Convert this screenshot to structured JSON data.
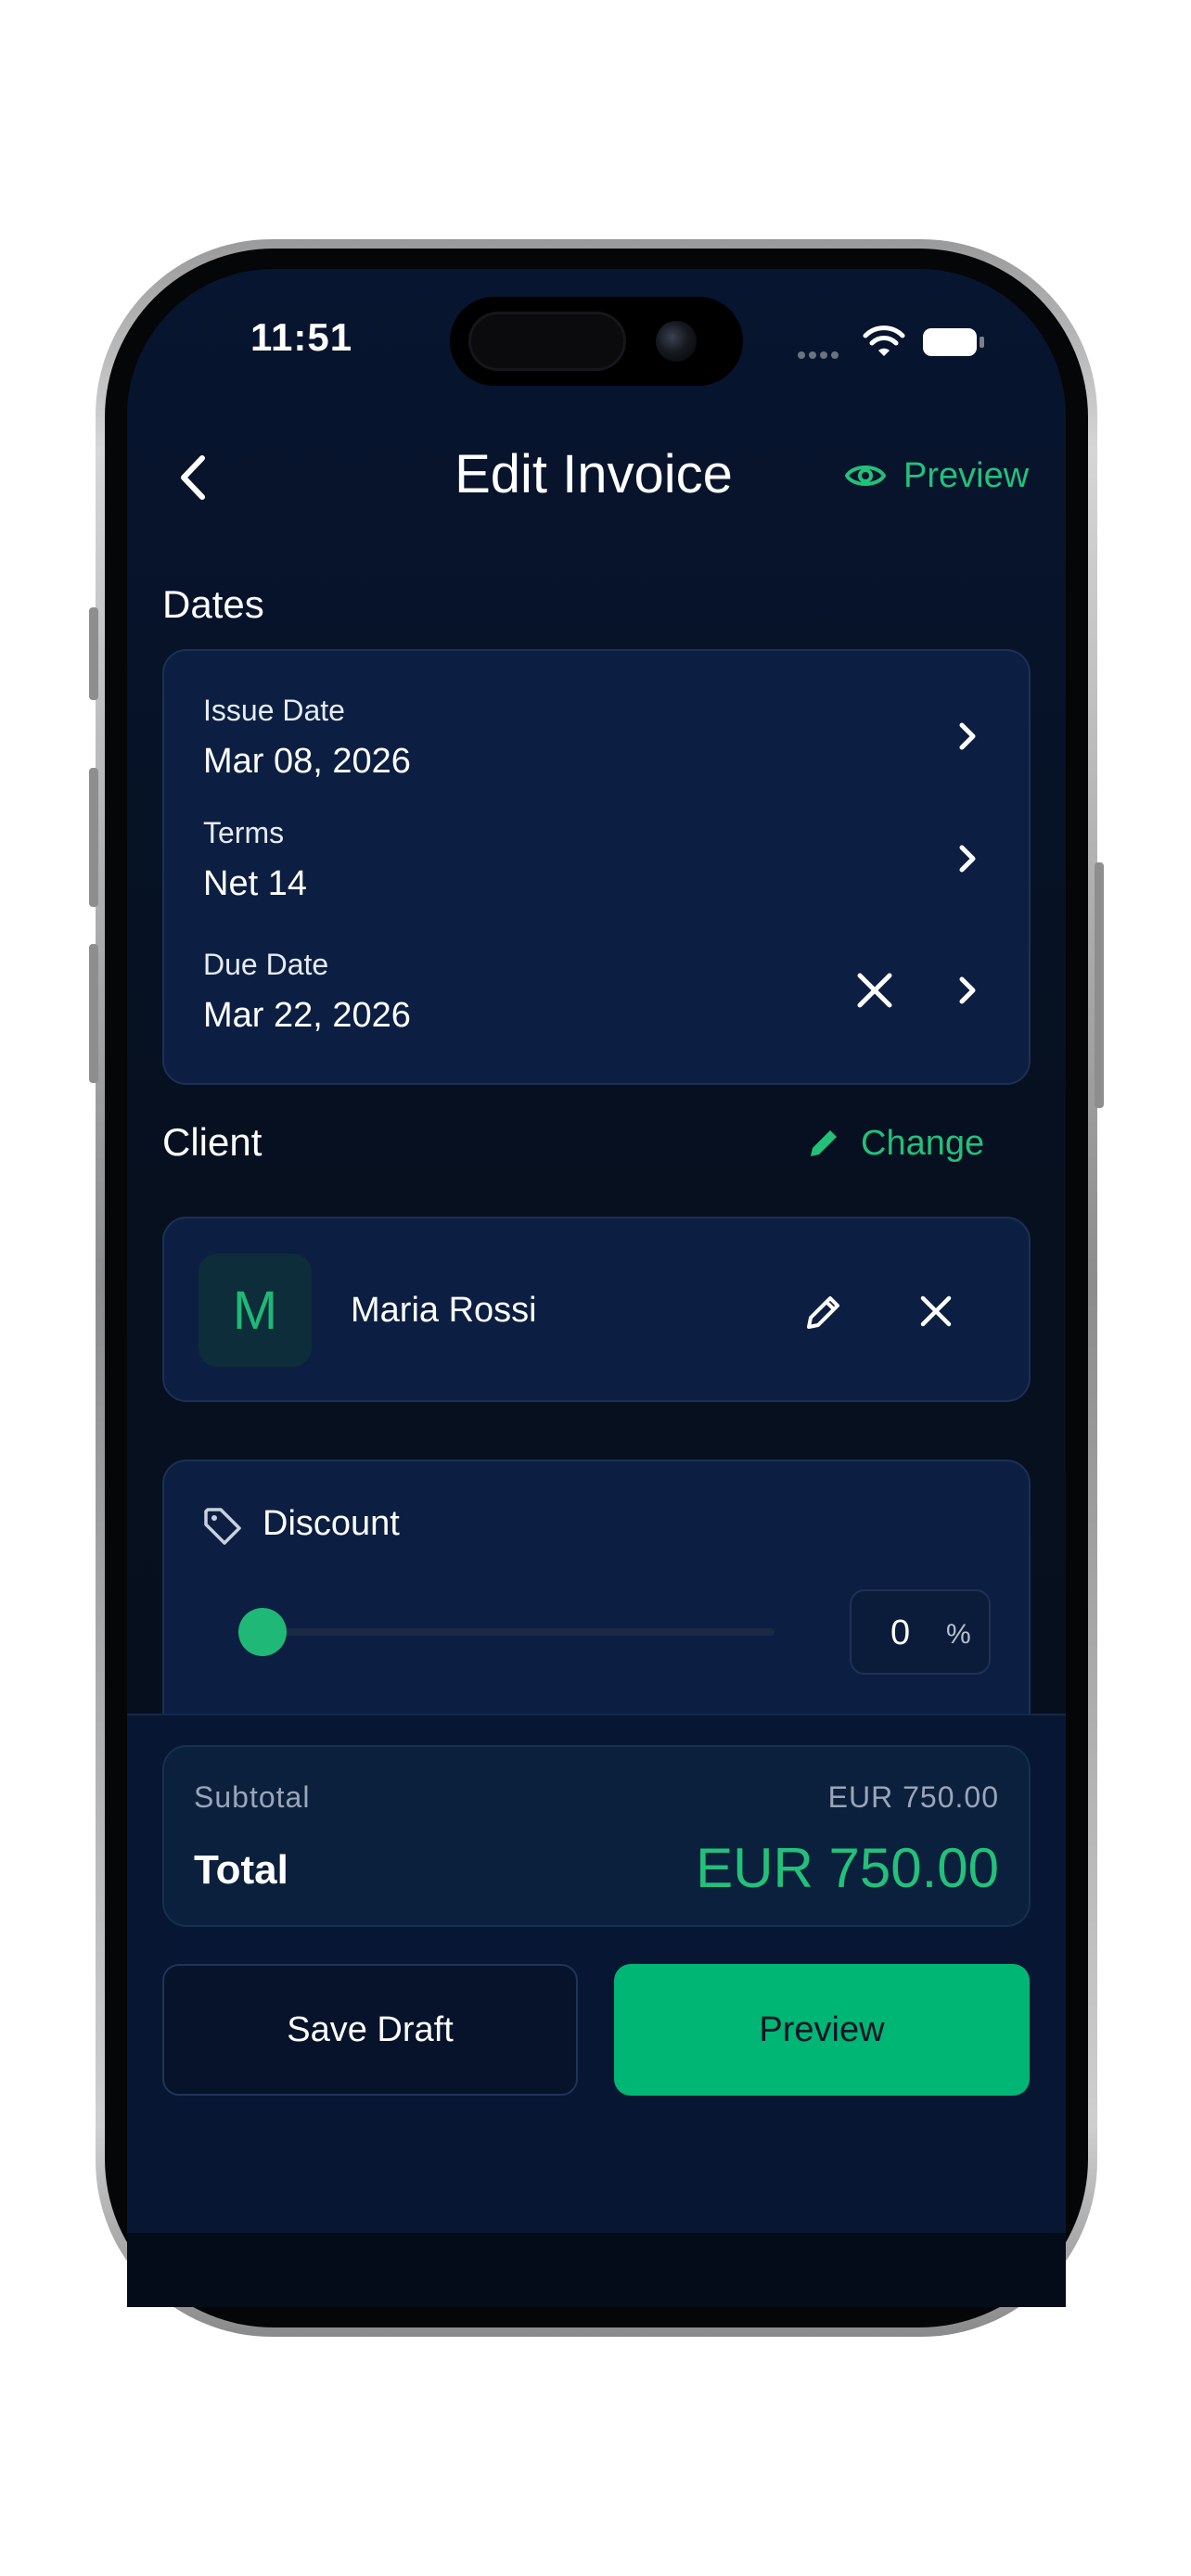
{
  "status_bar": {
    "time": "11:51"
  },
  "header": {
    "title": "Edit Invoice",
    "preview_label": "Preview",
    "icons": {
      "back": "chevron-left-icon",
      "preview": "eye-icon"
    }
  },
  "dates": {
    "section_title": "Dates",
    "issue_date": {
      "label": "Issue Date",
      "value": "Mar 08, 2026"
    },
    "terms": {
      "label": "Terms",
      "value": "Net 14"
    },
    "due_date": {
      "label": "Due Date",
      "value": "Mar 22, 2026"
    }
  },
  "client": {
    "section_title": "Client",
    "change_label": "Change",
    "avatar_initial": "M",
    "name": "Maria Rossi"
  },
  "discount": {
    "label": "Discount",
    "value": "0",
    "unit": "%",
    "slider_fraction": 0
  },
  "totals": {
    "subtotal_label": "Subtotal",
    "subtotal_value": "EUR 750.00",
    "total_label": "Total",
    "total_value": "EUR 750.00"
  },
  "actions": {
    "save_draft_label": "Save Draft",
    "preview_label": "Preview"
  },
  "colors": {
    "accent": "#22c17a",
    "primary_button": "#00b675",
    "background": "#071530",
    "card": "#0c1f42"
  }
}
